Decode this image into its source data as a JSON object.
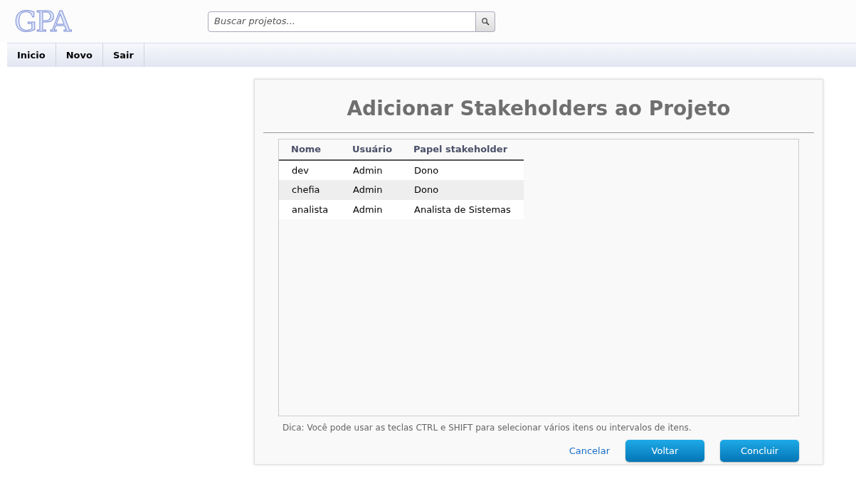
{
  "logo": {
    "text": "GPA"
  },
  "search": {
    "placeholder": "Buscar projetos..."
  },
  "nav": [
    {
      "label": "Inicio"
    },
    {
      "label": "Novo"
    },
    {
      "label": "Sair"
    }
  ],
  "dialog": {
    "title": "Adicionar Stakeholders ao Projeto",
    "table": {
      "columns": [
        "Nome",
        "Usuário",
        "Papel stakeholder"
      ],
      "rows": [
        [
          "dev",
          "Admin",
          "Dono"
        ],
        [
          "chefia",
          "Admin",
          "Dono"
        ],
        [
          "analista",
          "Admin",
          "Analista de Sistemas"
        ]
      ]
    },
    "hint": "Dica: Você pode usar as teclas CTRL e SHIFT para selecionar vários itens ou intervalos de itens.",
    "cancel": "Cancelar",
    "buttons": [
      "Voltar",
      "Concluir"
    ]
  }
}
